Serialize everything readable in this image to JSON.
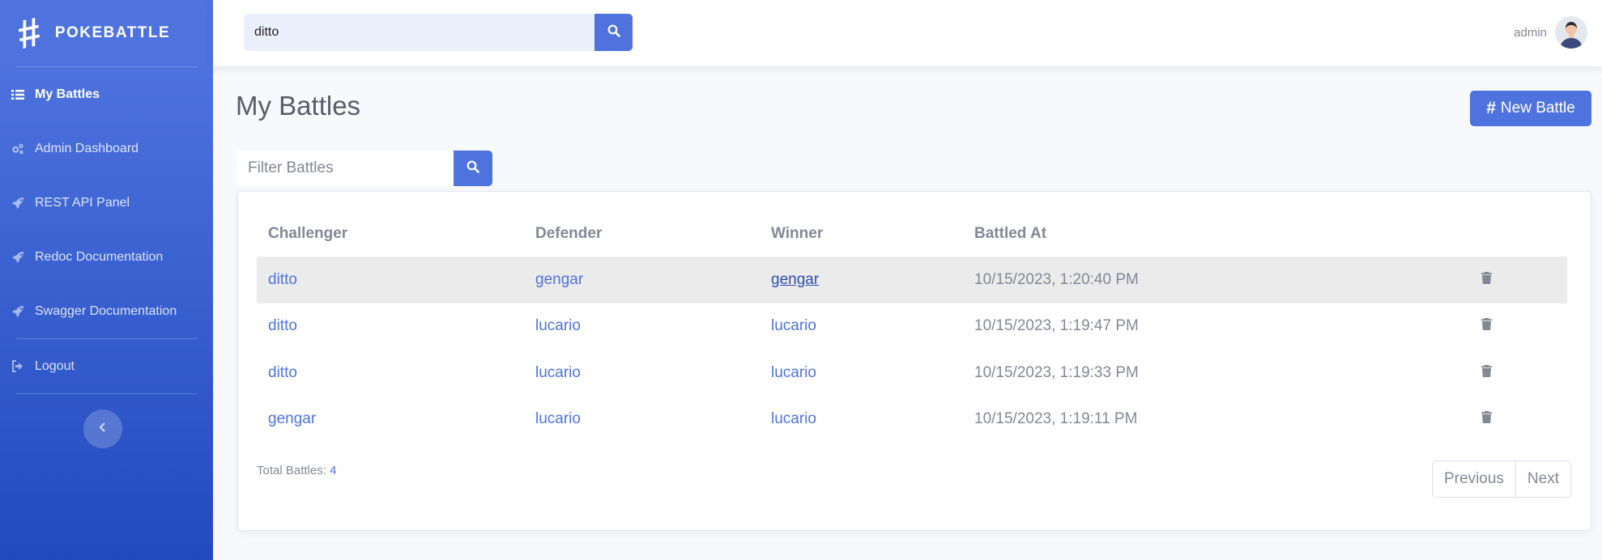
{
  "brand": {
    "icon": "#",
    "name": "POKEBATTLE"
  },
  "sidebar": {
    "items": [
      {
        "label": "My Battles",
        "icon": "list-icon"
      },
      {
        "label": "Admin Dashboard",
        "icon": "cogs-icon"
      },
      {
        "label": "REST API Panel",
        "icon": "rocket-icon"
      },
      {
        "label": "Redoc Documentation",
        "icon": "rocket-icon"
      },
      {
        "label": "Swagger Documentation",
        "icon": "rocket-icon"
      },
      {
        "label": "Logout",
        "icon": "sign-out-icon"
      }
    ]
  },
  "topbar": {
    "search_value": "ditto",
    "user": "admin"
  },
  "main": {
    "title": "My Battles",
    "new_battle_label": "New Battle",
    "new_battle_icon": "#",
    "filter_placeholder": "Filter Battles"
  },
  "table": {
    "headers": [
      "Challenger",
      "Defender",
      "Winner",
      "Battled At"
    ],
    "rows": [
      {
        "challenger": "ditto",
        "defender": "gengar",
        "winner": "gengar",
        "battled_at": "10/15/2023, 1:20:40 PM"
      },
      {
        "challenger": "ditto",
        "defender": "lucario",
        "winner": "lucario",
        "battled_at": "10/15/2023, 1:19:47 PM"
      },
      {
        "challenger": "ditto",
        "defender": "lucario",
        "winner": "lucario",
        "battled_at": "10/15/2023, 1:19:33 PM"
      },
      {
        "challenger": "gengar",
        "defender": "lucario",
        "winner": "lucario",
        "battled_at": "10/15/2023, 1:19:11 PM"
      }
    ]
  },
  "footer": {
    "total_label": "Total Battles:",
    "total_count": "4",
    "previous": "Previous",
    "next": "Next"
  },
  "colors": {
    "primary": "#4e73df",
    "sidebar_dark": "#224abe",
    "text_muted": "#858796",
    "highlight_row": "#ebebeb"
  }
}
